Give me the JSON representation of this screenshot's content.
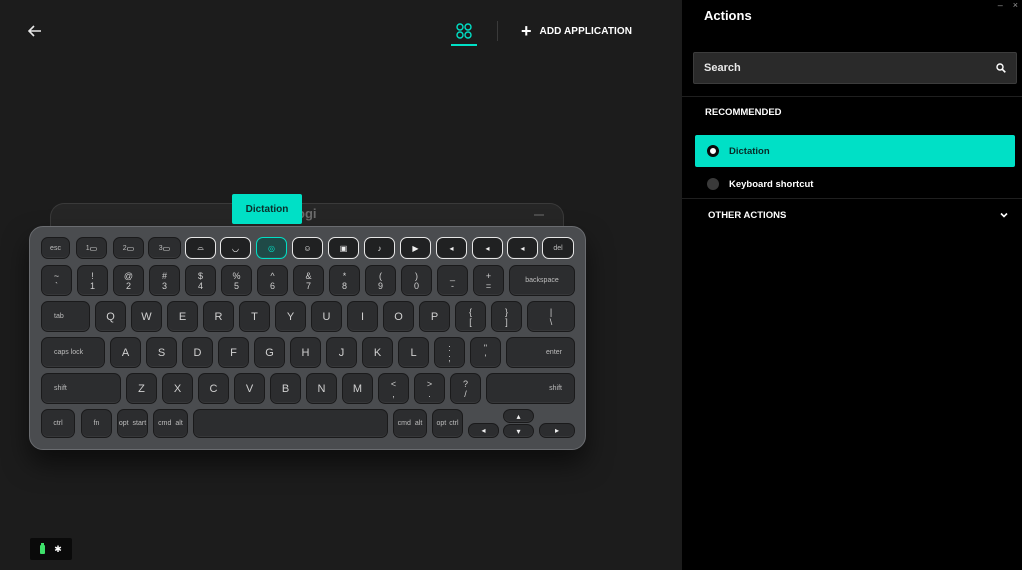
{
  "header": {
    "back_icon": "arrow-left-icon",
    "apps_icon": "apps-grid-icon",
    "add_application_label": "ADD APPLICATION",
    "accent": "#00e0c6"
  },
  "keyboard": {
    "logo": "ogi",
    "tooltip": "Dictation",
    "rows": {
      "fn": [
        "esc",
        "1",
        "2",
        "3",
        "",
        "",
        "",
        "",
        "",
        "",
        "",
        "",
        "",
        "",
        "del"
      ],
      "num_top": [
        "~",
        "!",
        "@",
        "#",
        "$",
        "%",
        "^",
        "&",
        "*",
        "(",
        ")",
        "_",
        "+"
      ],
      "num_bottom": [
        "`",
        "1",
        "2",
        "3",
        "4",
        "5",
        "6",
        "7",
        "8",
        "9",
        "0",
        "-",
        "="
      ],
      "backspace": "backspace",
      "tab": "tab",
      "qwerty": [
        "Q",
        "W",
        "E",
        "R",
        "T",
        "Y",
        "U",
        "I",
        "O",
        "P"
      ],
      "brackets_top": [
        "{",
        "}",
        "|"
      ],
      "brackets_bottom": [
        "[",
        "]",
        "\\"
      ],
      "caps": "caps lock",
      "asdf": [
        "A",
        "S",
        "D",
        "F",
        "G",
        "H",
        "J",
        "K",
        "L"
      ],
      "semi_top": [
        ":",
        "\""
      ],
      "semi_bottom": [
        ";",
        "'"
      ],
      "enter": "enter",
      "shift_left": "shift",
      "zxcv": [
        "Z",
        "X",
        "C",
        "V",
        "B",
        "N",
        "M"
      ],
      "punct_top": [
        "<",
        ">",
        "?"
      ],
      "punct_bottom": [
        ",",
        ".",
        "/"
      ],
      "shift_right": "shift",
      "ctrl": "ctrl",
      "fn_key": "fn",
      "opt": "opt",
      "start": "start",
      "cmd": "cmd",
      "alt": "alt",
      "cmd_r": "cmd",
      "alt_r": "alt",
      "opt_r": "opt",
      "ctrl_r": "ctrl"
    }
  },
  "status": {
    "battery_icon": "battery-icon",
    "bluetooth_icon": "bluetooth-icon",
    "battery_color": "#3ee06a"
  },
  "panel": {
    "title": "Actions",
    "window_controls": [
      "–",
      "×"
    ],
    "search": {
      "placeholder": "Search",
      "value": ""
    },
    "recommended_label": "RECOMMENDED",
    "recommended": [
      {
        "label": "Dictation",
        "selected": true
      },
      {
        "label": "Keyboard shortcut",
        "selected": false
      }
    ],
    "other_actions_label": "OTHER ACTIONS"
  }
}
